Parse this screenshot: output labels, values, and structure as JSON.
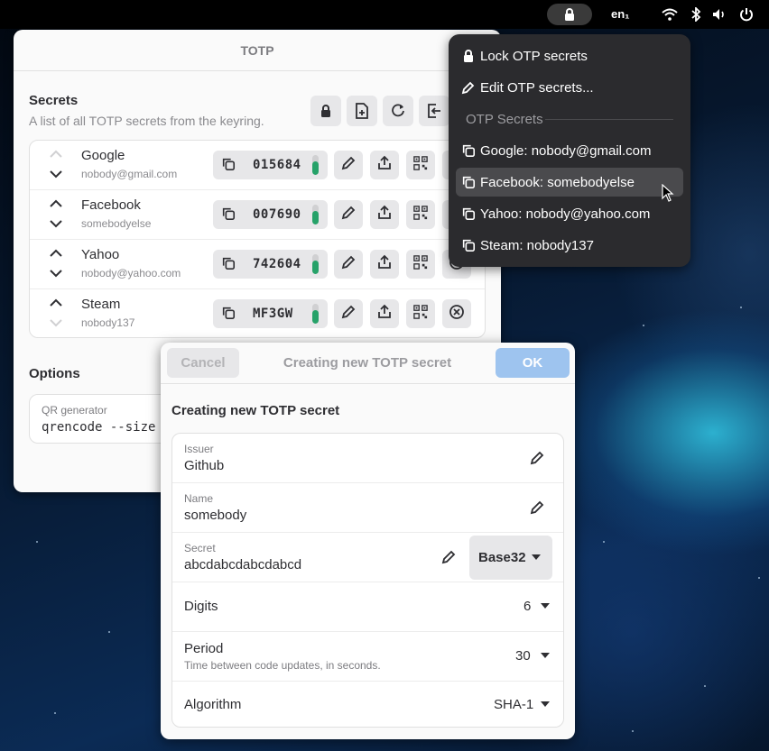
{
  "topbar": {
    "language": "en₁",
    "icons": [
      "lock-icon",
      "wifi-icon",
      "bluetooth-icon",
      "volume-icon",
      "power-icon"
    ]
  },
  "window": {
    "title": "TOTP",
    "secrets_title": "Secrets",
    "secrets_subtitle": "A list of all TOTP secrets from the keyring.",
    "header_buttons": [
      "lock-icon",
      "add-icon",
      "refresh-icon",
      "import-icon"
    ],
    "secrets": [
      {
        "issuer": "Google",
        "name": "nobody@gmail.com",
        "code": "015684",
        "progress": 0.7
      },
      {
        "issuer": "Facebook",
        "name": "somebodyelse",
        "code": "007690",
        "progress": 0.7
      },
      {
        "issuer": "Yahoo",
        "name": "nobody@yahoo.com",
        "code": "742604",
        "progress": 0.7
      },
      {
        "issuer": "Steam",
        "name": "nobody137",
        "code": "MF3GW",
        "progress": 0.7
      }
    ],
    "options_title": "Options",
    "qr_label": "QR generator",
    "qr_value": "qrencode --size"
  },
  "dialog": {
    "cancel_label": "Cancel",
    "title": "Creating new TOTP secret",
    "ok_label": "OK",
    "section_title": "Creating new TOTP secret",
    "issuer_label": "Issuer",
    "issuer_value": "Github",
    "name_label": "Name",
    "name_value": "somebody",
    "secret_label": "Secret",
    "secret_value": "abcdabcdabcdabcd",
    "encoding_value": "Base32",
    "digits_label": "Digits",
    "digits_value": "6",
    "period_label": "Period",
    "period_subtitle": "Time between code updates, in seconds.",
    "period_value": "30",
    "algorithm_label": "Algorithm",
    "algorithm_value": "SHA-1"
  },
  "menu": {
    "lock_label": "Lock OTP secrets",
    "edit_label": "Edit OTP secrets...",
    "header": "OTP Secrets",
    "items": [
      "Google: nobody@gmail.com",
      "Facebook: somebodyelse",
      "Yahoo: nobody@yahoo.com",
      "Steam: nobody137"
    ],
    "hovered_index": 1
  },
  "colors": {
    "accent": "#9ec4ef",
    "progress": "#26a269",
    "menu_bg": "#2b2b2e"
  }
}
